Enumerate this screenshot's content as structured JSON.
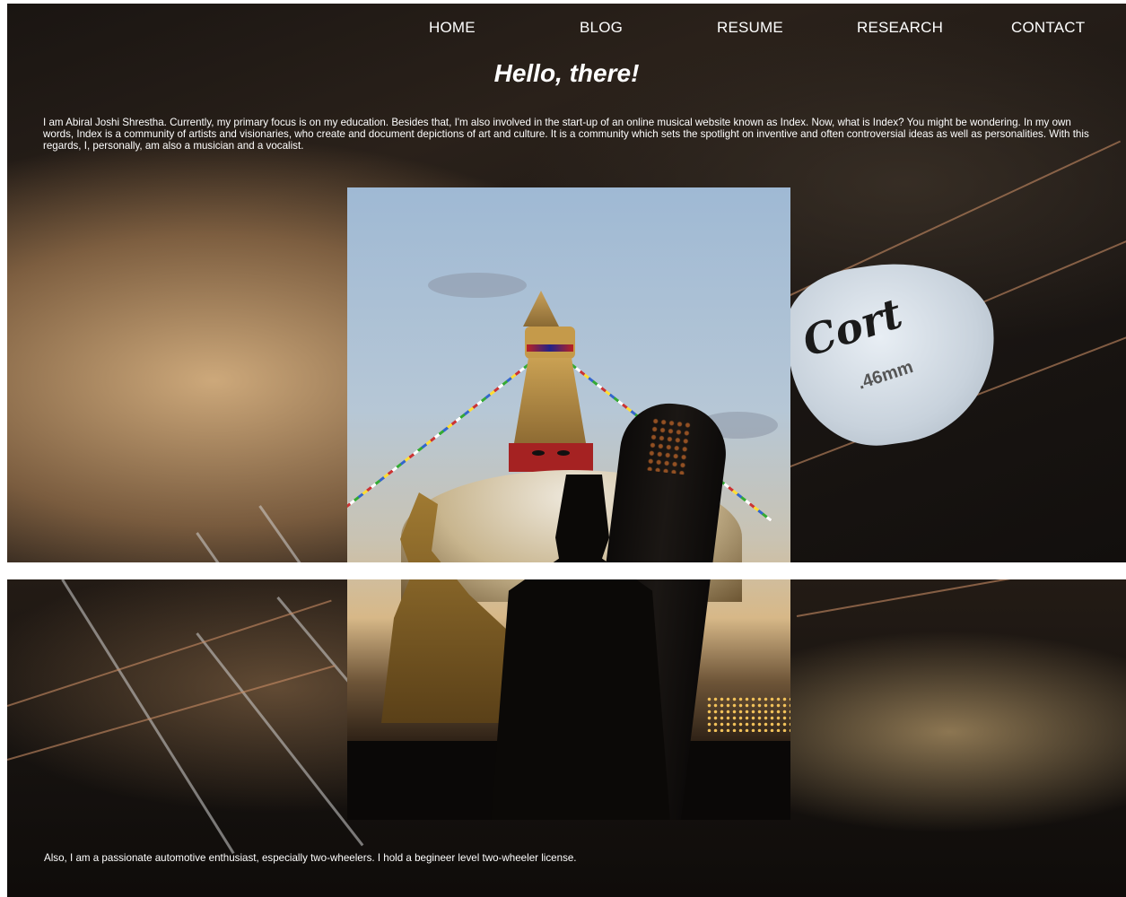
{
  "nav": {
    "items": [
      {
        "label": "HOME"
      },
      {
        "label": "BLOG"
      },
      {
        "label": "RESUME"
      },
      {
        "label": "RESEARCH"
      },
      {
        "label": "CONTACT"
      }
    ]
  },
  "hero": {
    "heading": "Hello, there!"
  },
  "intro": {
    "paragraph": "I am Abiral Joshi Shrestha. Currently, my primary focus is on my education. Besides that, I'm also involved in the start-up of an online musical website known as Index. Now, what is Index? You might be wondering. In my own words, Index is a community of artists and visionaries, who create and document depictions of art and culture. It is a community which sets the spotlight on inventive and often controversial ideas as well as personalities. With this regards, I, personally, am also a musician and a vocalist."
  },
  "background_pick": {
    "brand": "Cort",
    "size": ".46mm"
  },
  "second_section": {
    "paragraph": "Also, I am a passionate automotive enthusiast, especially two-wheelers. I hold a begineer level two-wheeler license."
  },
  "colors": {
    "text": "#ffffff",
    "page_gap": "#ffffff"
  }
}
